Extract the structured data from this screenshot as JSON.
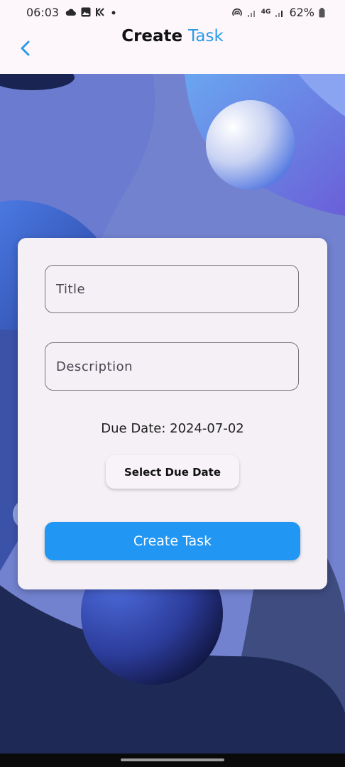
{
  "status_bar": {
    "time": "06:03",
    "battery": "62%",
    "network": "4G",
    "icons": [
      "cloud-icon",
      "image-icon",
      "app-icon",
      "dot-icon",
      "hotspot-icon",
      "signal-icon",
      "battery-icon"
    ]
  },
  "app_bar": {
    "title_main": "Create",
    "title_accent": "Task",
    "back_icon": "chevron-left-icon",
    "accent_color": "#2a9be8"
  },
  "form": {
    "title_placeholder": "Title",
    "description_placeholder": "Description",
    "due_date_text": "Due Date: 2024-07-02",
    "select_due_date_label": "Select Due Date",
    "create_task_label": "Create Task",
    "primary_color": "#2196f3"
  }
}
